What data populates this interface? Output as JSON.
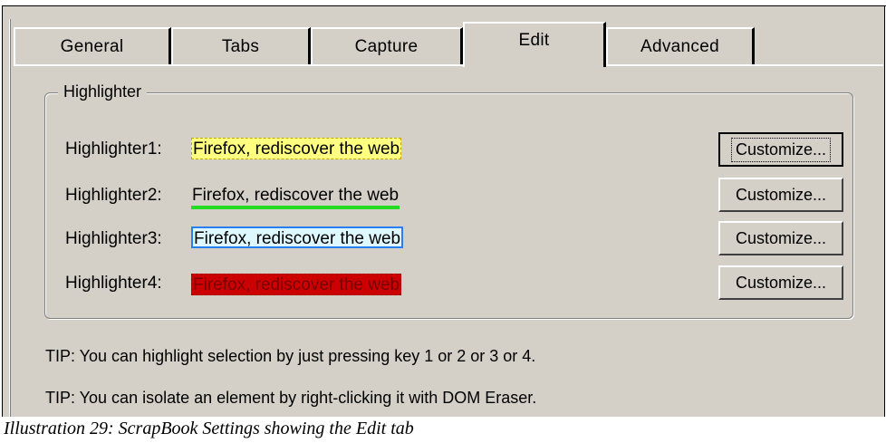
{
  "tabs": [
    {
      "label": "General",
      "active": false
    },
    {
      "label": "Tabs",
      "active": false
    },
    {
      "label": "Capture",
      "active": false
    },
    {
      "label": "Edit",
      "active": true
    },
    {
      "label": "Advanced",
      "active": false
    }
  ],
  "highlighter": {
    "group_label": "Highlighter",
    "rows": [
      {
        "label": "Highlighter1:",
        "sample": "Firefox, rediscover the web",
        "button": "Customize..."
      },
      {
        "label": "Highlighter2:",
        "sample": "Firefox, rediscover the web",
        "button": "Customize..."
      },
      {
        "label": "Highlighter3:",
        "sample": "Firefox, rediscover the web",
        "button": "Customize..."
      },
      {
        "label": "Highlighter4:",
        "sample": "Firefox, rediscover the web",
        "button": "Customize..."
      }
    ]
  },
  "tips": [
    "TIP: You can highlight selection by just pressing key 1 or 2 or 3 or 4.",
    "TIP: You can isolate an element by right-clicking it with DOM Eraser."
  ],
  "caption": "Illustration 29: ScrapBook Settings showing the Edit tab",
  "colors": {
    "dialog_bg": "#d4d0c8",
    "hl1_bg": "#ffff80",
    "hl2_underline": "#22dd22",
    "hl3_bg": "#ddf8ff",
    "hl3_border": "#2a7ff0",
    "hl4_bg": "#cc0000"
  }
}
